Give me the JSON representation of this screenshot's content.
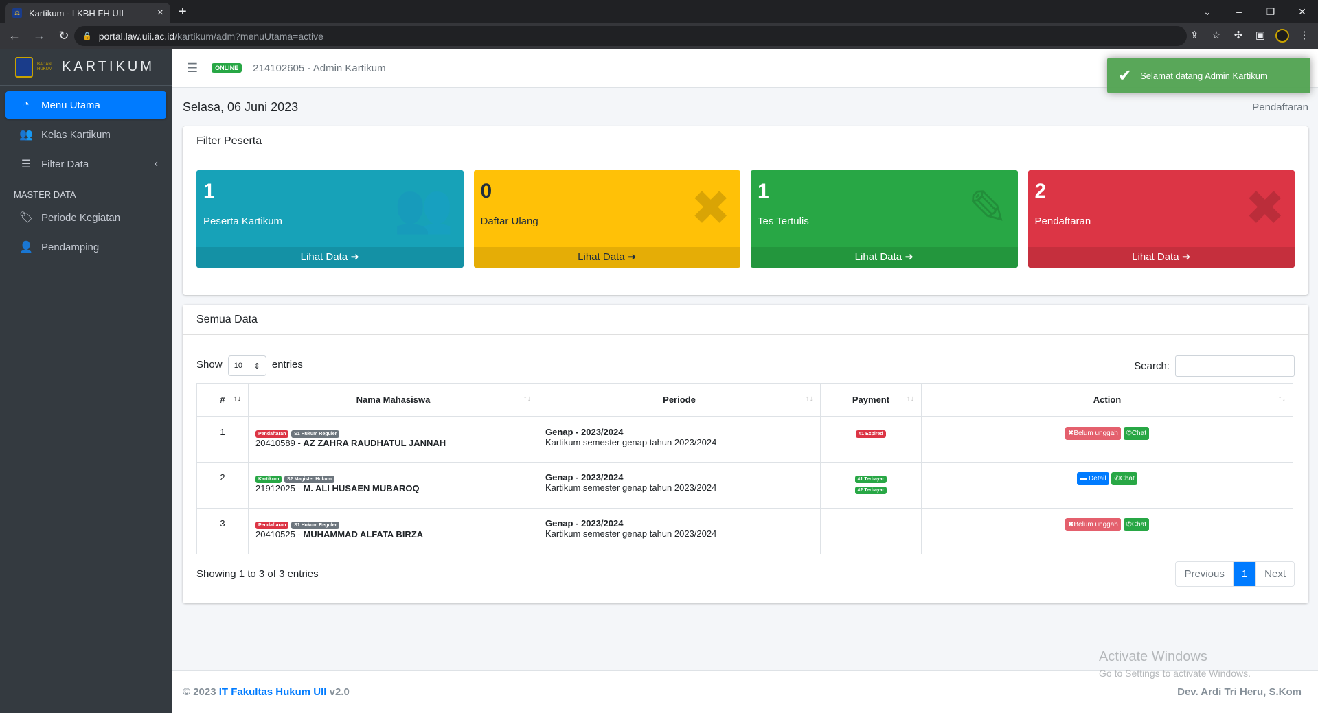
{
  "browser": {
    "tab_title": "Kartikum - LKBH FH UII",
    "url_host": "portal.law.uii.ac.id",
    "url_path": "/kartikum/adm?menuUtama=active"
  },
  "brand": {
    "name": "KARTIKUM",
    "logo_text": "BADAN HUKUM"
  },
  "sidebar": {
    "items": [
      {
        "label": "Menu Utama",
        "icon": "dashboard-icon"
      },
      {
        "label": "Kelas Kartikum",
        "icon": "users-icon"
      },
      {
        "label": "Filter Data",
        "icon": "list-icon"
      }
    ],
    "section": "MASTER DATA",
    "master": [
      {
        "label": "Periode Kegiatan",
        "icon": "tag-icon"
      },
      {
        "label": "Pendamping",
        "icon": "user-cog-icon"
      }
    ]
  },
  "topbar": {
    "status": "ONLINE",
    "user": "214102605 - Admin Kartikum"
  },
  "toast": {
    "message": "Selamat datang Admin Kartikum"
  },
  "page": {
    "date": "Selasa, 06 Juni 2023",
    "breadcrumb": "Pendaftaran"
  },
  "filter": {
    "title": "Filter Peserta",
    "boxes": [
      {
        "count": "1",
        "label": "Peserta Kartikum",
        "link": "Lihat Data",
        "color": "#17a2b8",
        "icon": "users-icon"
      },
      {
        "count": "0",
        "label": "Daftar Ulang",
        "link": "Lihat Data",
        "color": "#ffc107",
        "icon": "times-icon"
      },
      {
        "count": "1",
        "label": "Tes Tertulis",
        "link": "Lihat Data",
        "color": "#28a745",
        "icon": "edit-icon"
      },
      {
        "count": "2",
        "label": "Pendaftaran",
        "link": "Lihat Data",
        "color": "#dc3545",
        "icon": "times-icon"
      }
    ]
  },
  "table": {
    "title": "Semua Data",
    "show": "Show",
    "entries_value": "10",
    "entries": "entries",
    "search": "Search:",
    "headers": [
      "#",
      "Nama Mahasiswa",
      "Periode",
      "Payment",
      "Action"
    ],
    "rows": [
      {
        "no": "1",
        "b1": "Pendaftaran",
        "b2": "S1 Hukum Reguler",
        "nim": "20410589 - ",
        "name": "AZ ZAHRA RAUDHATUL JANNAH",
        "periode": "Genap - 2023/2024",
        "desc": "Kartikum semester genap tahun 2023/2024",
        "pay1": "#1 Expired",
        "pay2": "",
        "a1": "Belum unggah",
        "a2": "Chat"
      },
      {
        "no": "2",
        "b1": "Kartikum",
        "b2": "S2 Magister Hukum",
        "nim": "21912025 - ",
        "name": "M. ALI HUSAEN MUBAROQ",
        "periode": "Genap - 2023/2024",
        "desc": "Kartikum semester genap tahun 2023/2024",
        "pay1": "#1 Terbayar",
        "pay2": "#2 Terbayar",
        "a1": "Detail",
        "a2": "Chat"
      },
      {
        "no": "3",
        "b1": "Pendaftaran",
        "b2": "S1 Hukum Reguler",
        "nim": "20410525 - ",
        "name": "MUHAMMAD ALFATA BIRZA",
        "periode": "Genap - 2023/2024",
        "desc": "Kartikum semester genap tahun 2023/2024",
        "pay1": "",
        "pay2": "",
        "a1": "Belum unggah",
        "a2": "Chat"
      }
    ],
    "info": "Showing 1 to 3 of 3 entries",
    "prev": "Previous",
    "page": "1",
    "next": "Next"
  },
  "footer": {
    "copy": "© 2023",
    "org": "IT Fakultas Hukum UII",
    "ver": "v2.0",
    "dev": "Dev. Ardi Tri Heru, S.Kom"
  },
  "watermark": {
    "title": "Activate Windows",
    "sub": "Go to Settings to activate Windows."
  }
}
